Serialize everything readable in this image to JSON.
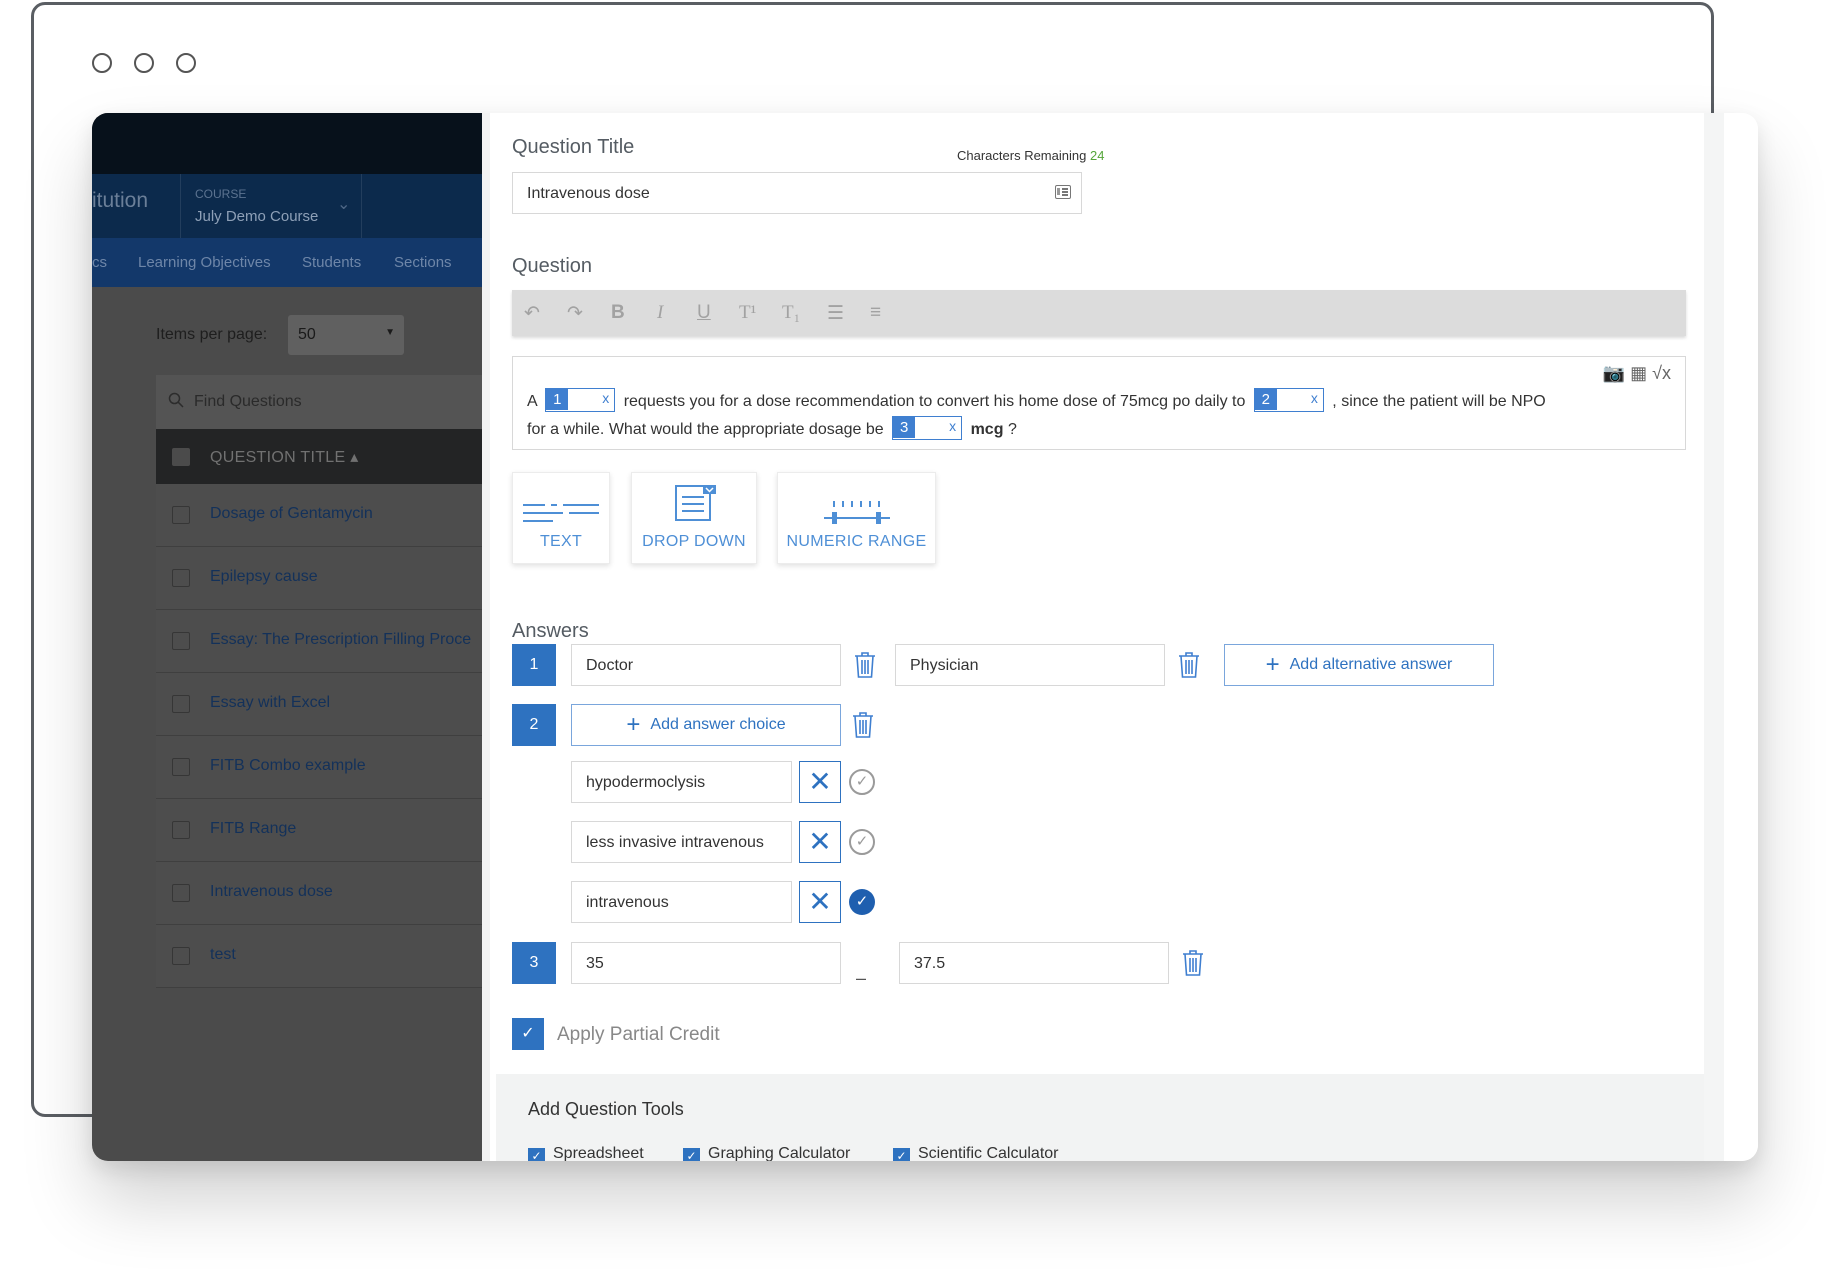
{
  "colors": {
    "accent": "#2e72c0",
    "success": "#55a53a",
    "nav": "#0c2a4c"
  },
  "left_pane": {
    "institution": "itution",
    "course_label": "COURSE",
    "course_name": "July Demo Course",
    "tabs": [
      "cs",
      "Learning Objectives",
      "Students",
      "Sections"
    ],
    "items_per_page_label": "Items per page:",
    "items_per_page_value": "50",
    "search_placeholder": "Find Questions",
    "column_header": "QUESTION TITLE ▴",
    "questions": [
      "Dosage of Gentamycin",
      "Epilepsy cause",
      "Essay: The Prescription Filling Proce",
      "Essay with Excel",
      "FITB Combo example",
      "FITB Range",
      "Intravenous dose",
      "test"
    ]
  },
  "editor": {
    "title_label": "Question Title",
    "chars_remaining_label": "Characters Remaining",
    "chars_remaining_value": "24",
    "title_value": "Intravenous dose",
    "question_label": "Question",
    "toolbar": [
      "↶",
      "↷",
      "B",
      "I",
      "U",
      "T¹",
      "T₁",
      "☰",
      "≡"
    ],
    "question_line1": {
      "part1": "A",
      "blank1": "1",
      "part2": "requests you for a dose recommendation to convert his home dose of 75mcg po daily to",
      "blank2": "2",
      "part3": ", since the patient will be NPO"
    },
    "question_line2": {
      "part1": "for a while.   What would the appropriate dosage be",
      "blank3": "3",
      "unit": "mcg",
      "part2": "?"
    },
    "blank_remove": "x",
    "answer_types": [
      "TEXT",
      "DROP DOWN",
      "NUMERIC RANGE"
    ],
    "answers_label": "Answers",
    "answers": {
      "a1": {
        "num": "1",
        "value": "Doctor",
        "alt": "Physician",
        "add_alt": "Add alternative answer"
      },
      "a2": {
        "num": "2",
        "add_choice": "Add answer choice",
        "choices": [
          "hypodermoclysis",
          "less invasive intravenous",
          "intravenous"
        ],
        "correct_index": 2
      },
      "a3": {
        "num": "3",
        "min": "35",
        "max": "37.5",
        "separator": "–"
      }
    },
    "partial_credit_label": "Apply Partial Credit",
    "tools_heading": "Add Question Tools",
    "tools": [
      "Spreadsheet",
      "Graphing Calculator",
      "Scientific Calculator"
    ]
  }
}
